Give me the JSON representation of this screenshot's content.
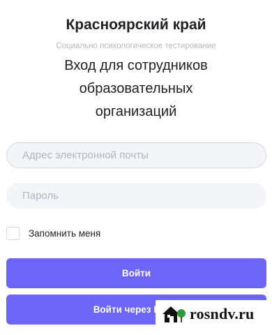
{
  "header": {
    "region": "Красноярский край",
    "subtitle": "Социально психологическое тестирование",
    "heading_lines": [
      "Вход для сотрудников",
      "образовательных",
      "организаций"
    ]
  },
  "form": {
    "email_placeholder": "Адрес электронной почты",
    "password_placeholder": "Пароль",
    "remember_label": "Запомнить меня",
    "remember_checked": false,
    "login_button": "Войти",
    "alt_login_button": "Войти через КИАС"
  },
  "watermark": {
    "text": "rosndv.ru",
    "icon": "house-with-tree-icon"
  },
  "colors": {
    "accent": "#6c65f7",
    "input_bg": "#f3f5f9",
    "subtitle": "#b4b8c0"
  }
}
